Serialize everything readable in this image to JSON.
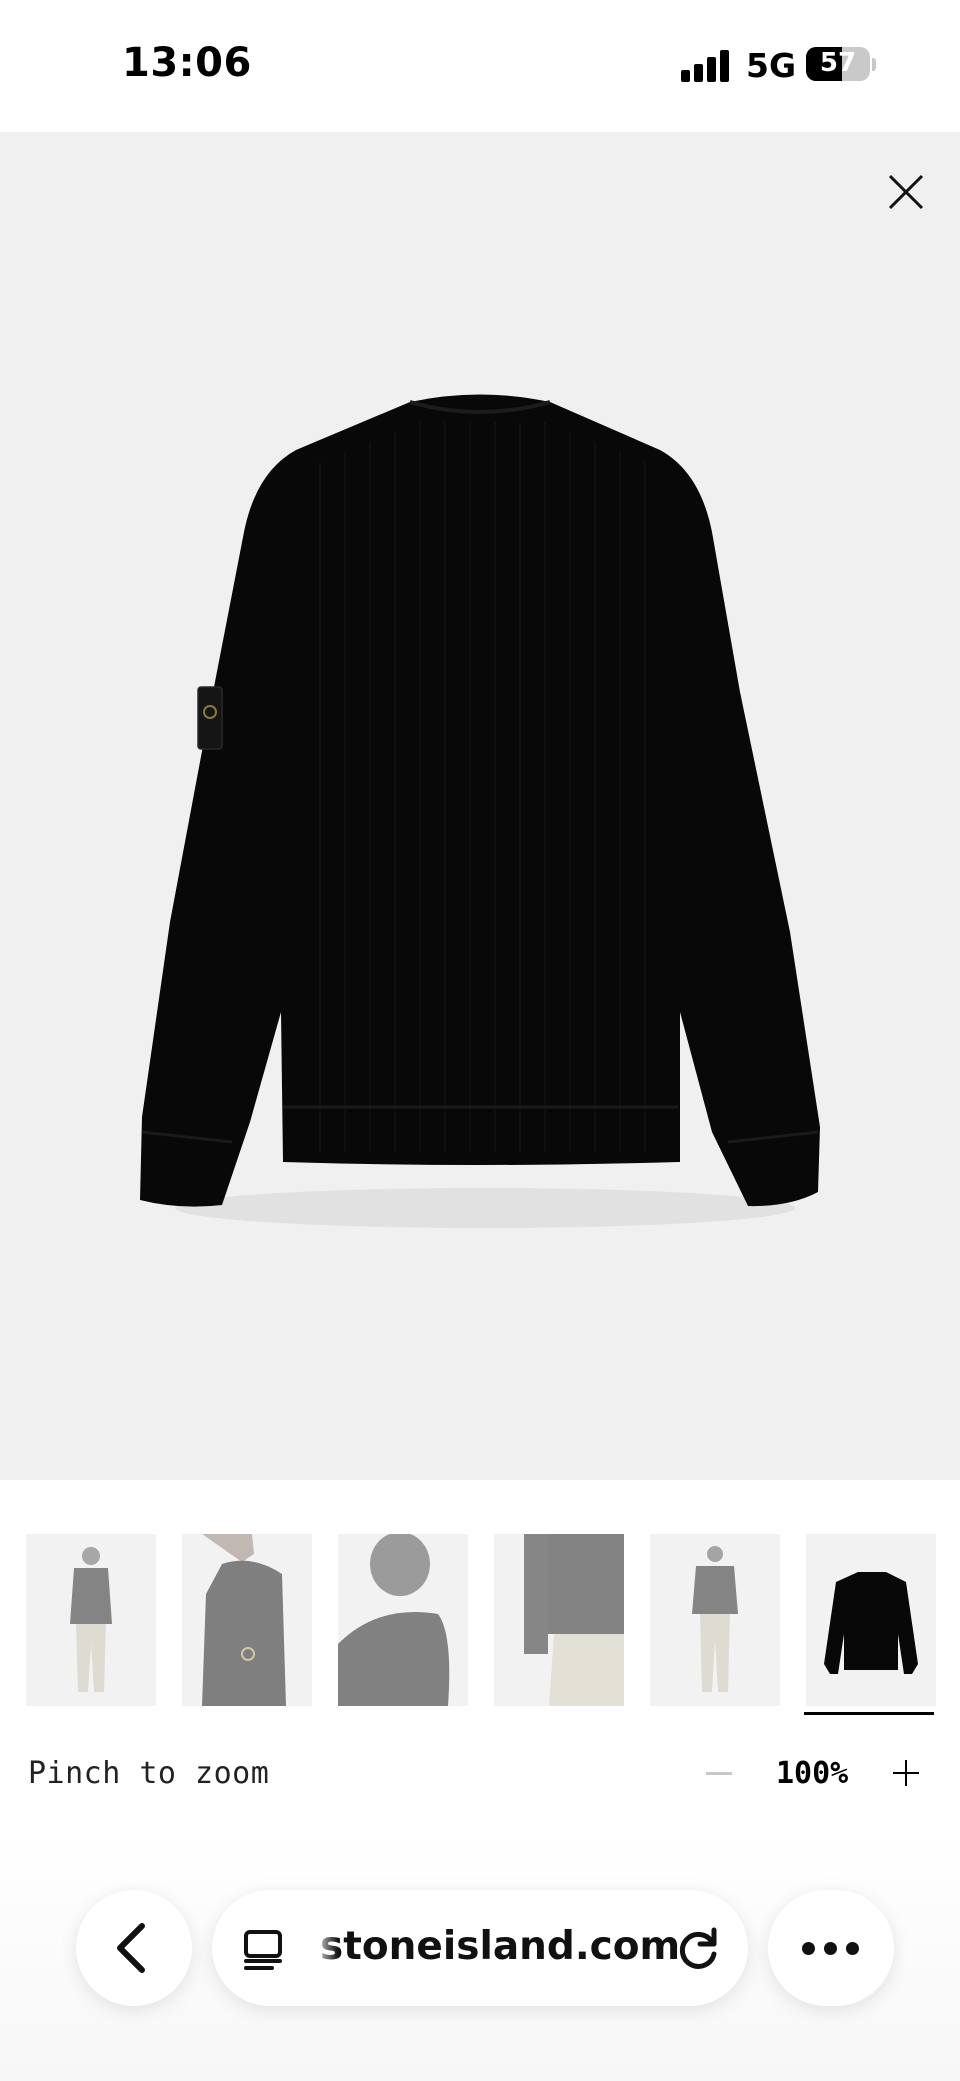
{
  "status_bar": {
    "time": "13:06",
    "network": "5G",
    "battery_level": "57",
    "signal_bars": 4
  },
  "viewer": {
    "close_icon": "close-icon",
    "background_color": "#f0f0f0",
    "product_color": "#080808"
  },
  "thumbnails": {
    "count": 6,
    "selected_index": 6
  },
  "zoom": {
    "hint": "Pinch to zoom",
    "value": "100%",
    "minus_icon": "minus-icon",
    "plus_icon": "plus-icon"
  },
  "browser": {
    "url": "stoneisland.com",
    "back_icon": "chevron-left-icon",
    "tab_icon": "reader-icon",
    "reload_icon": "reload-icon",
    "more_icon": "more-icon"
  }
}
